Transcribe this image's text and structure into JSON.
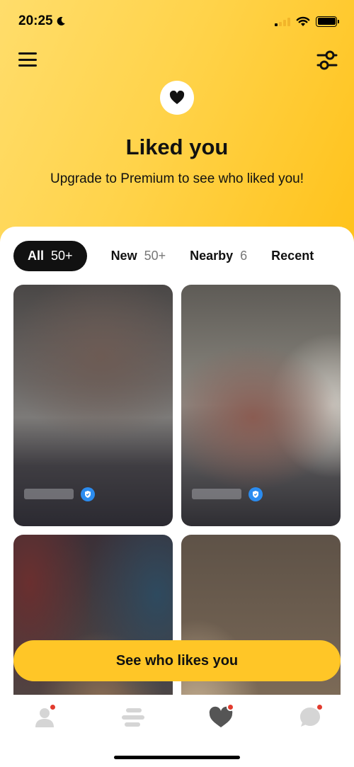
{
  "status_bar": {
    "time": "20:25"
  },
  "header": {
    "title": "Liked you",
    "subtitle": "Upgrade to Premium to see who liked you!"
  },
  "tabs": [
    {
      "label": "All",
      "count": "50+",
      "active": true
    },
    {
      "label": "New",
      "count": "50+",
      "active": false
    },
    {
      "label": "Nearby",
      "count": "6",
      "active": false
    },
    {
      "label": "Recent",
      "count": "",
      "active": false
    }
  ],
  "cards": [
    {
      "verified": true
    },
    {
      "verified": true
    },
    {
      "verified": false
    },
    {
      "verified": false
    }
  ],
  "cta": {
    "label": "See who likes you"
  },
  "bottom_nav": [
    {
      "icon": "profile-icon",
      "badge": true
    },
    {
      "icon": "discover-icon",
      "badge": false
    },
    {
      "icon": "liked-you-icon",
      "badge": true,
      "active": true
    },
    {
      "icon": "chat-icon",
      "badge": true
    }
  ],
  "colors": {
    "accent": "#ffc627",
    "badge": "#e23b2e",
    "verified": "#2b8cf0"
  }
}
